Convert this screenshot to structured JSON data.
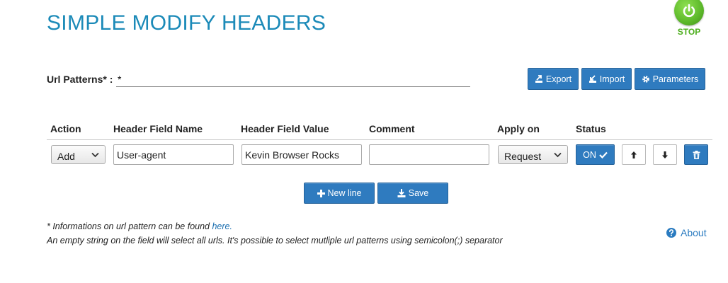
{
  "header": {
    "title": "SIMPLE MODIFY HEADERS",
    "stop_label": "STOP"
  },
  "url": {
    "label": "Url Patterns* :",
    "value": "*"
  },
  "toolbar": {
    "export_label": "Export",
    "import_label": "Import",
    "parameters_label": "Parameters"
  },
  "table": {
    "columns": [
      "Action",
      "Header Field Name",
      "Header Field Value",
      "Comment",
      "Apply on",
      "Status"
    ],
    "rows": [
      {
        "action": "Add",
        "field_name": "User-agent",
        "field_value": "Kevin Browser Rocks",
        "comment": "",
        "apply_on": "Request",
        "status": "ON"
      }
    ]
  },
  "actions": {
    "new_line_label": "New line",
    "save_label": "Save"
  },
  "footer": {
    "note1_text": "* Informations on url pattern can be found ",
    "note1_link": "here.",
    "note2_text": "An empty string on the field will select all urls. It's possible to select mutliple url patterns using semicolon(;) separator",
    "about_label": "About"
  },
  "colors": {
    "title": "#1b8ab8",
    "button": "#2f7bbf",
    "stop": "#5cb82a"
  },
  "icons": [
    "power-icon",
    "export-icon",
    "import-icon",
    "gear-icon",
    "check-icon",
    "arrow-up-icon",
    "arrow-down-icon",
    "trash-icon",
    "plus-icon",
    "download-icon",
    "question-circle-icon",
    "chevron-down-icon"
  ]
}
